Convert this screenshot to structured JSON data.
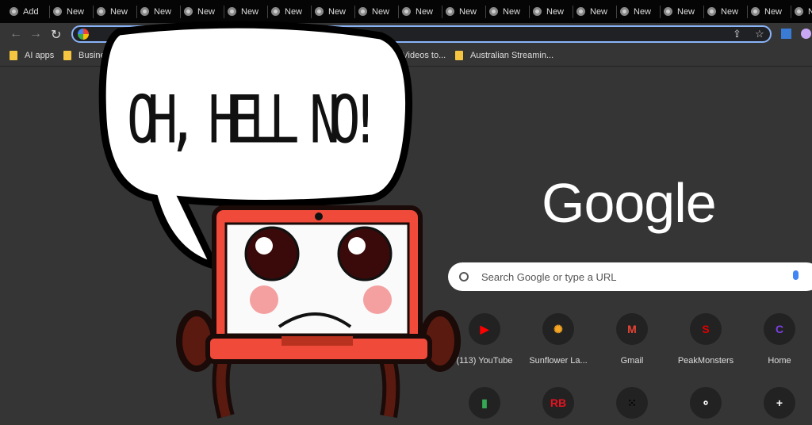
{
  "tabs": [
    "Add",
    "New",
    "New",
    "New",
    "New",
    "New",
    "New",
    "New",
    "New",
    "New",
    "New",
    "New",
    "New",
    "New",
    "New",
    "New",
    "New",
    "New",
    "New"
  ],
  "bookmarks": [
    {
      "label": "AI apps"
    },
    {
      "label": "Business"
    },
    {
      "label": "ube Videos to..."
    },
    {
      "label": "Australian Streamin..."
    }
  ],
  "logo": "Google",
  "search": {
    "placeholder": "Search Google or type a URL"
  },
  "shortcuts": [
    {
      "label": "(113) YouTube",
      "icon": "youtube-icon",
      "color": "#ff0000"
    },
    {
      "label": "Sunflower La...",
      "icon": "sunflower-icon",
      "color": "#f5a623"
    },
    {
      "label": "Gmail",
      "icon": "gmail-icon",
      "color": "#ea4335"
    },
    {
      "label": "PeakMonsters",
      "icon": "peakmonsters-icon",
      "color": "#e00000"
    },
    {
      "label": "Home",
      "icon": "canva-icon",
      "color": "#7b3fe4"
    },
    {
      "label": "",
      "icon": "shopping-bag-icon",
      "color": "#34a853"
    },
    {
      "label": "",
      "icon": "redbubble-icon",
      "color": "#e41321"
    },
    {
      "label": "",
      "icon": "dots-app-icon",
      "color": "#000000"
    },
    {
      "label": "",
      "icon": "ring-dots-icon",
      "color": "#ffffff"
    },
    {
      "label": "",
      "icon": "add-shortcut-icon",
      "color": "#ffffff"
    }
  ],
  "speech_bubble": "OH, HELL NO!"
}
